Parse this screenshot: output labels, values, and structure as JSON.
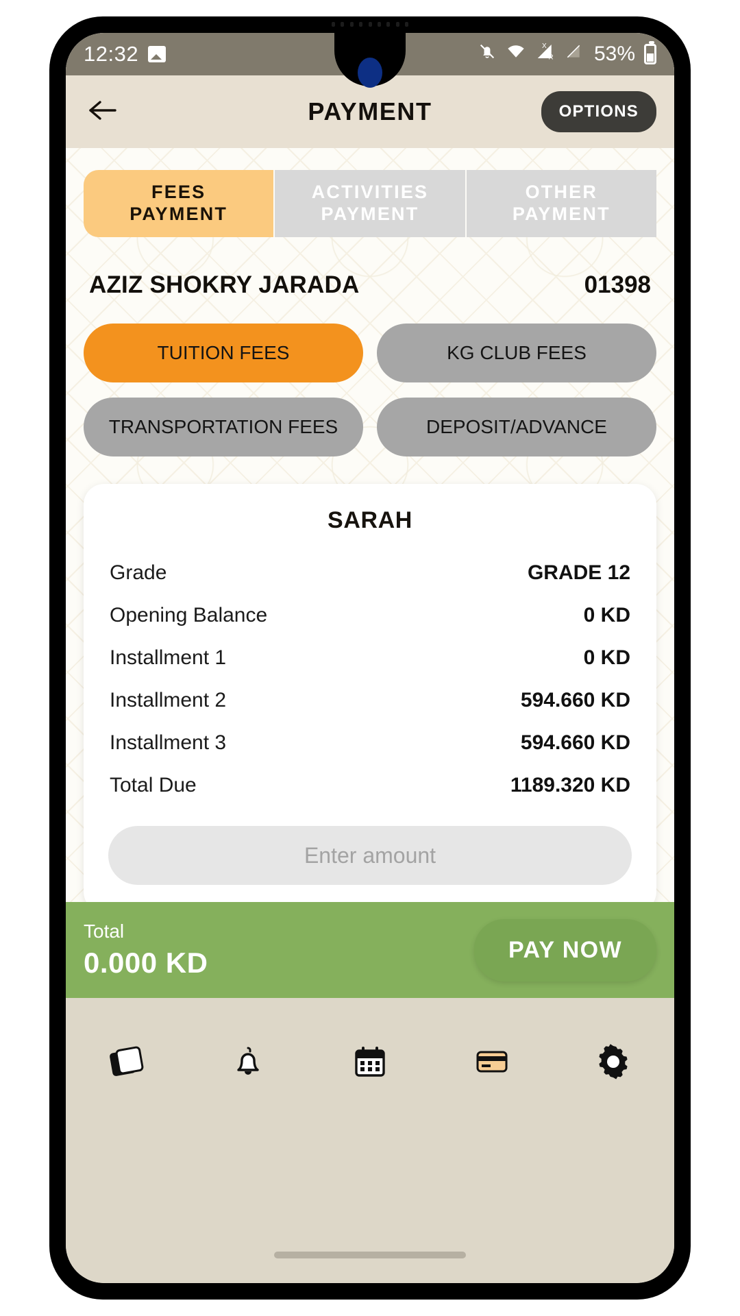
{
  "status_bar": {
    "time": "12:32",
    "battery_percent": "53%",
    "icons": [
      "image-icon",
      "notifications-off-icon",
      "wifi-icon",
      "signal-roaming-icon",
      "signal-empty-icon",
      "battery-icon"
    ]
  },
  "header": {
    "back_icon": "back-arrow-icon",
    "title": "PAYMENT",
    "options_label": "OPTIONS"
  },
  "tabs": [
    {
      "label_line1": "FEES",
      "label_line2": "PAYMENT",
      "active": true
    },
    {
      "label_line1": "ACTIVITIES",
      "label_line2": "PAYMENT",
      "active": false
    },
    {
      "label_line1": "OTHER",
      "label_line2": "PAYMENT",
      "active": false
    }
  ],
  "student": {
    "name": "AZIZ SHOKRY JARADA",
    "id": "01398"
  },
  "fee_categories": [
    {
      "label": "TUITION FEES",
      "selected": true
    },
    {
      "label": "KG CLUB FEES",
      "selected": false
    },
    {
      "label": "TRANSPORTATION FEES",
      "selected": false
    },
    {
      "label": "DEPOSIT/ADVANCE",
      "selected": false
    }
  ],
  "detail_card": {
    "title": "SARAH",
    "rows": [
      {
        "label": "Grade",
        "value": "GRADE 12"
      },
      {
        "label": "Opening Balance",
        "value": "0 KD"
      },
      {
        "label": "Installment 1",
        "value": "0 KD"
      },
      {
        "label": "Installment 2",
        "value": "594.660 KD"
      },
      {
        "label": "Installment 3",
        "value": "594.660 KD"
      },
      {
        "label": "Total Due",
        "value": "1189.320 KD"
      }
    ],
    "amount_placeholder": "Enter amount",
    "amount_value": ""
  },
  "total_bar": {
    "label": "Total",
    "value": "0.000 KD",
    "pay_label": "PAY NOW"
  },
  "bottom_nav": [
    {
      "icon": "cards-icon"
    },
    {
      "icon": "bell-icon"
    },
    {
      "icon": "calendar-icon"
    },
    {
      "icon": "credit-card-icon"
    },
    {
      "icon": "gear-icon"
    }
  ],
  "colors": {
    "accent_orange": "#f3921e",
    "tab_active": "#fbca7f",
    "green_bar": "#85b05c",
    "header_bg": "#e8e0d2",
    "nav_bg": "#ddd7c8"
  }
}
